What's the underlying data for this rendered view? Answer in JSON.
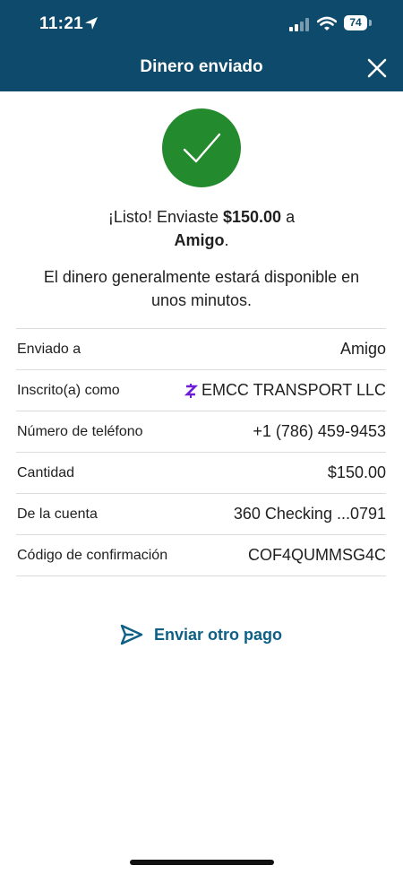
{
  "status_bar": {
    "time": "11:21",
    "battery": "74",
    "icons": [
      "location-arrow-icon",
      "signal-icon",
      "wifi-icon",
      "battery-icon"
    ]
  },
  "header": {
    "title": "Dinero enviado",
    "close_icon": "close-icon",
    "background": "#0d4a6b"
  },
  "success": {
    "icon": "checkmark-icon",
    "color": "#238a2e"
  },
  "message": {
    "prefix": "¡Listo! Enviaste ",
    "amount": "$150.00",
    "middle": " a",
    "recipient": "Amigo",
    "suffix": ".",
    "availability": "El dinero generalmente estará disponible en unos minutos."
  },
  "details": [
    {
      "label": "Enviado a",
      "value": "Amigo"
    },
    {
      "label": "Inscrito(a) como",
      "value": "EMCC TRANSPORT LLC",
      "icon": "zelle-icon"
    },
    {
      "label": "Número de teléfono",
      "value": "+1 (786) 459-9453"
    },
    {
      "label": "Cantidad",
      "value": "$150.00"
    },
    {
      "label": "De la cuenta",
      "value": "360 Checking ...0791"
    },
    {
      "label": "Código de confirmación",
      "value": "COF4QUMMSG4C"
    }
  ],
  "actions": {
    "send_again_label": "Enviar otro pago",
    "send_again_icon": "send-icon",
    "link_color": "#0e5f85"
  }
}
